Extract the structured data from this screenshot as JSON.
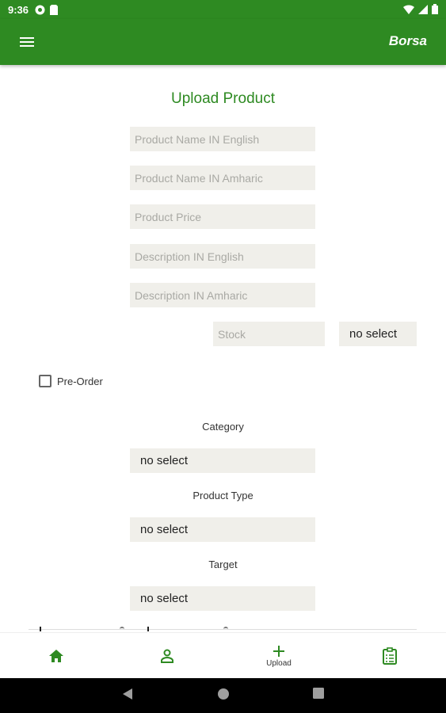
{
  "status_bar": {
    "time": "9:36"
  },
  "app_bar": {
    "brand": "Borsa"
  },
  "form": {
    "title": "Upload Product",
    "name_en_placeholder": "Product Name IN English",
    "name_am_placeholder": "Product Name IN Amharic",
    "price_placeholder": "Product Price",
    "desc_en_placeholder": "Description IN English",
    "desc_am_placeholder": "Description IN Amharic",
    "stock_placeholder": "Stock",
    "stock_unit_select": "no select",
    "preorder_label": "Pre-Order",
    "preorder_checked": false,
    "category_label": "Category",
    "category_select": "no select",
    "product_type_label": "Product Type",
    "product_type_select": "no select",
    "target_label": "Target",
    "target_select": "no select"
  },
  "bottom_nav": {
    "items": [
      {
        "icon": "home-icon",
        "label": ""
      },
      {
        "icon": "person-icon",
        "label": ""
      },
      {
        "icon": "plus-icon",
        "label": "Upload"
      },
      {
        "icon": "clipboard-icon",
        "label": ""
      }
    ]
  },
  "colors": {
    "primary": "#2e8a22",
    "field_bg": "#f0efea"
  }
}
